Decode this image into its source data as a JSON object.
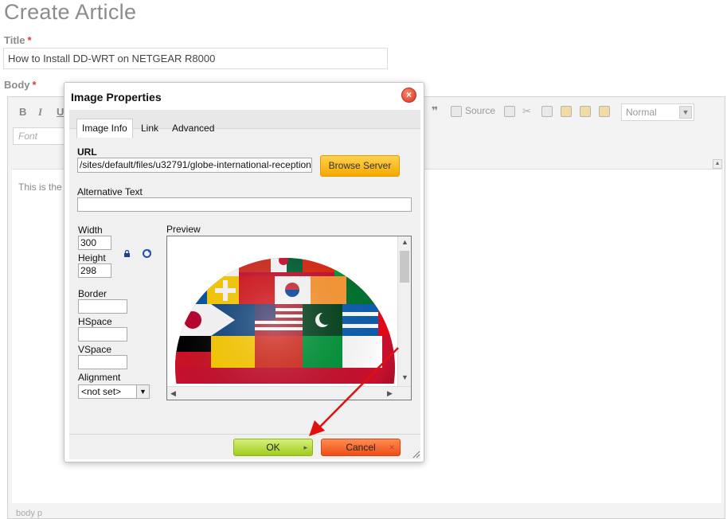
{
  "page": {
    "title": "Create Article",
    "title_field_label": "Title",
    "title_value": "How to Install DD-WRT on NETGEAR R8000",
    "body_field_label": "Body",
    "required_marker": "*"
  },
  "editor": {
    "bold": "B",
    "italic": "I",
    "underline": "U",
    "source_label": "Source",
    "format_value": "Normal",
    "font_placeholder": "Font",
    "content_text": "This is the",
    "status_path": "body  p"
  },
  "dialog": {
    "title": "Image Properties",
    "close_glyph": "×",
    "tabs": [
      "Image Info",
      "Link",
      "Advanced"
    ],
    "url_label": "URL",
    "url_value": "/sites/default/files/u32791/globe-international-reception",
    "browse_label": "Browse Server",
    "alt_label": "Alternative Text",
    "alt_value": "",
    "width_label": "Width",
    "width_value": "300",
    "height_label": "Height",
    "height_value": "298",
    "border_label": "Border",
    "hspace_label": "HSpace",
    "vspace_label": "VSpace",
    "alignment_label": "Alignment",
    "alignment_value": "<not set>",
    "preview_label": "Preview",
    "ok_label": "OK",
    "cancel_label": "Cancel"
  },
  "icons": [
    "close-icon",
    "lock-icon",
    "reset-size-icon",
    "dropdown-arrow-icon",
    "resize-grip-icon",
    "annotation-arrow"
  ],
  "colors": {
    "ok_button": "#9fcc1d",
    "cancel_button": "#ef4d15",
    "browse_button": "#f5a800",
    "annotation_arrow": "#e01010"
  }
}
